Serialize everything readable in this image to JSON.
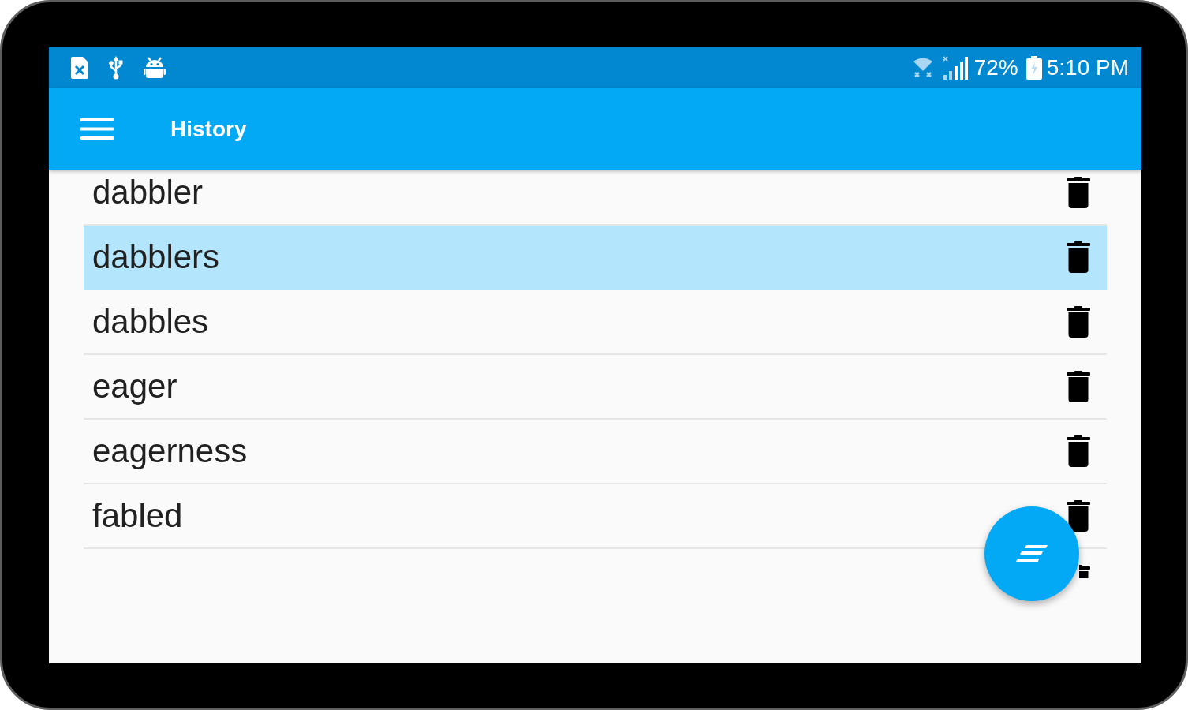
{
  "status_bar": {
    "battery_percent": "72%",
    "time": "5:10 PM"
  },
  "app_bar": {
    "title": "History"
  },
  "history": [
    {
      "word": "dabbler",
      "selected": false
    },
    {
      "word": "dabblers",
      "selected": true
    },
    {
      "word": "dabbles",
      "selected": false
    },
    {
      "word": "eager",
      "selected": false
    },
    {
      "word": "eagerness",
      "selected": false
    },
    {
      "word": "fabled",
      "selected": false
    },
    {
      "selected": false
    }
  ]
}
